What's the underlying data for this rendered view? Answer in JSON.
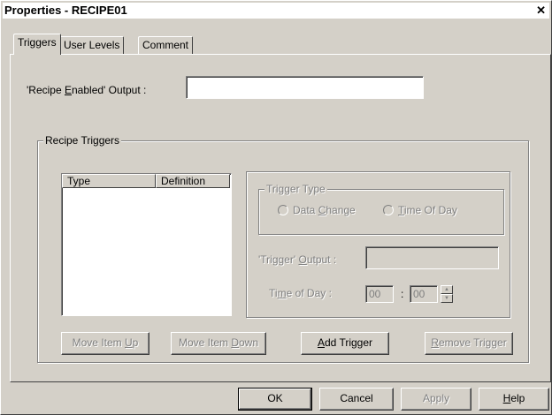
{
  "window": {
    "title": "Properties - RECIPE01",
    "close_glyph": "✕"
  },
  "tabs": [
    {
      "label": "Triggers",
      "active": true
    },
    {
      "label": "User Levels",
      "active": false
    },
    {
      "label": "Comment",
      "active": false
    }
  ],
  "triggers_tab": {
    "recipe_enabled_output": {
      "label_pre": "'Recipe ",
      "label_accel": "E",
      "label_post": "nabled' Output :",
      "value": ""
    },
    "recipe_triggers_group": {
      "title": "Recipe Triggers",
      "list_headers": [
        "Type",
        "Definition"
      ],
      "rows": []
    },
    "trigger_type_group": {
      "title": "Trigger Type",
      "option_data_change": {
        "pre": "Data ",
        "accel": "C",
        "post": "hange"
      },
      "option_time_of_day": {
        "pre": "",
        "accel": "T",
        "post": "ime Of Day"
      }
    },
    "trigger_output": {
      "label_pre": "'Trigger' ",
      "label_accel": "O",
      "label_post": "utput :",
      "value": ""
    },
    "time_of_day": {
      "label_pre": "Ti",
      "label_accel": "m",
      "label_post": "e of Day :",
      "hours": "00",
      "separator": ":",
      "minutes": "00",
      "spin_up": "▲",
      "spin_down": "▼"
    },
    "buttons": {
      "move_up": {
        "pre": "Move Item ",
        "accel": "U",
        "post": "p"
      },
      "move_down": {
        "pre": "Move Item ",
        "accel": "D",
        "post": "own"
      },
      "add_trigger": {
        "pre": "",
        "accel": "A",
        "post": "dd Trigger"
      },
      "remove_trigger": {
        "pre": "",
        "accel": "R",
        "post": "emove Trigger"
      }
    }
  },
  "footer": {
    "ok": "OK",
    "cancel": "Cancel",
    "apply": "Apply",
    "help": {
      "pre": "",
      "accel": "H",
      "post": "elp"
    }
  }
}
